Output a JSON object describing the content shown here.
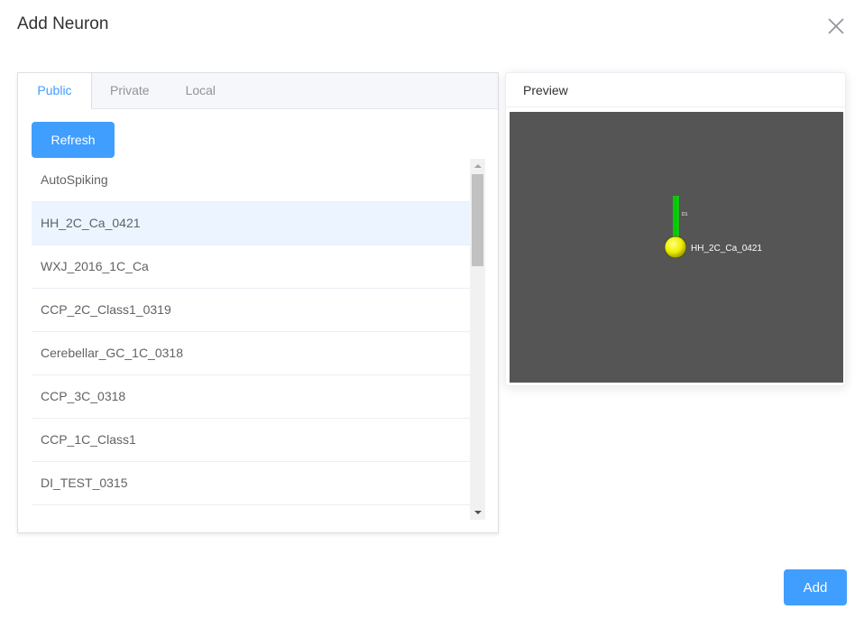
{
  "dialog": {
    "title": "Add Neuron"
  },
  "tabs": [
    {
      "label": "Public",
      "active": true
    },
    {
      "label": "Private",
      "active": false
    },
    {
      "label": "Local",
      "active": false
    }
  ],
  "refresh_label": "Refresh",
  "neuron_list": [
    {
      "name": "AutoSpiking",
      "selected": false
    },
    {
      "name": "HH_2C_Ca_0421",
      "selected": true
    },
    {
      "name": "WXJ_2016_1C_Ca",
      "selected": false
    },
    {
      "name": "CCP_2C_Class1_0319",
      "selected": false
    },
    {
      "name": "Cerebellar_GC_1C_0318",
      "selected": false
    },
    {
      "name": "CCP_3C_0318",
      "selected": false
    },
    {
      "name": "CCP_1C_Class1",
      "selected": false
    },
    {
      "name": "DI_TEST_0315",
      "selected": false
    }
  ],
  "preview": {
    "header": "Preview",
    "soma_label": "HH_2C_Ca_0421",
    "dendrite_label": "D1",
    "colors": {
      "background": "#555555",
      "soma": "#ffff00",
      "dendrite": "#00cc00"
    }
  },
  "add_label": "Add",
  "colors": {
    "accent": "#409eff",
    "selected_row": "#ecf5ff"
  }
}
